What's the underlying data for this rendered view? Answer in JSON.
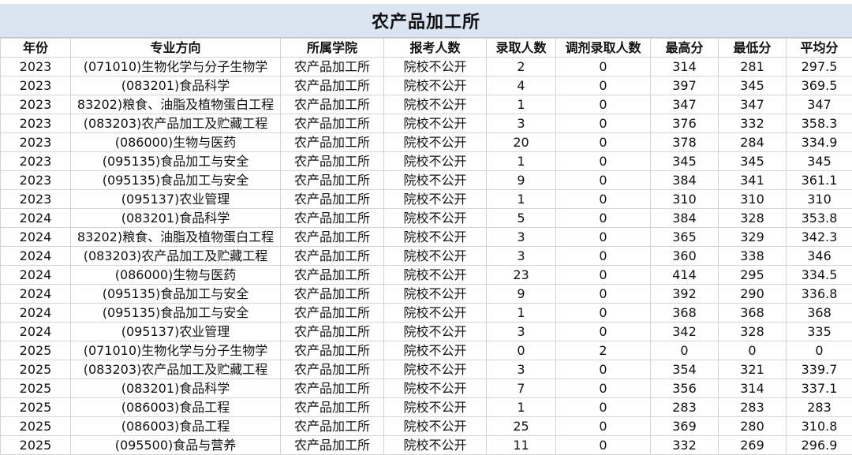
{
  "title": "农产品加工所",
  "headers": [
    "年份",
    "专业方向",
    "所属学院",
    "报考人数",
    "录取人数",
    "调剂录取人数",
    "最高分",
    "最低分",
    "平均分"
  ],
  "rows": [
    [
      "2023",
      "(071010)生物化学与分子生物学",
      "农产品加工所",
      "院校不公开",
      "2",
      "0",
      "314",
      "281",
      "297.5"
    ],
    [
      "2023",
      "(083201)食品科学",
      "农产品加工所",
      "院校不公开",
      "4",
      "0",
      "397",
      "345",
      "369.5"
    ],
    [
      "2023",
      "83202)粮食、油脂及植物蛋白工程",
      "农产品加工所",
      "院校不公开",
      "1",
      "0",
      "347",
      "347",
      "347"
    ],
    [
      "2023",
      "(083203)农产品加工及贮藏工程",
      "农产品加工所",
      "院校不公开",
      "3",
      "0",
      "376",
      "332",
      "358.3"
    ],
    [
      "2023",
      "(086000)生物与医药",
      "农产品加工所",
      "院校不公开",
      "20",
      "0",
      "378",
      "284",
      "334.9"
    ],
    [
      "2023",
      "(095135)食品加工与安全",
      "农产品加工所",
      "院校不公开",
      "1",
      "0",
      "345",
      "345",
      "345"
    ],
    [
      "2023",
      "(095135)食品加工与安全",
      "农产品加工所",
      "院校不公开",
      "9",
      "0",
      "384",
      "341",
      "361.1"
    ],
    [
      "2023",
      "(095137)农业管理",
      "农产品加工所",
      "院校不公开",
      "1",
      "0",
      "310",
      "310",
      "310"
    ],
    [
      "2024",
      "(083201)食品科学",
      "农产品加工所",
      "院校不公开",
      "5",
      "0",
      "384",
      "328",
      "353.8"
    ],
    [
      "2024",
      "83202)粮食、油脂及植物蛋白工程",
      "农产品加工所",
      "院校不公开",
      "3",
      "0",
      "365",
      "329",
      "342.3"
    ],
    [
      "2024",
      "(083203)农产品加工及贮藏工程",
      "农产品加工所",
      "院校不公开",
      "3",
      "0",
      "360",
      "338",
      "346"
    ],
    [
      "2024",
      "(086000)生物与医药",
      "农产品加工所",
      "院校不公开",
      "23",
      "0",
      "414",
      "295",
      "334.5"
    ],
    [
      "2024",
      "(095135)食品加工与安全",
      "农产品加工所",
      "院校不公开",
      "9",
      "0",
      "392",
      "290",
      "336.8"
    ],
    [
      "2024",
      "(095135)食品加工与安全",
      "农产品加工所",
      "院校不公开",
      "1",
      "0",
      "368",
      "368",
      "368"
    ],
    [
      "2024",
      "(095137)农业管理",
      "农产品加工所",
      "院校不公开",
      "3",
      "0",
      "342",
      "328",
      "335"
    ],
    [
      "2025",
      "(071010)生物化学与分子生物学",
      "农产品加工所",
      "院校不公开",
      "0",
      "2",
      "0",
      "0",
      "0"
    ],
    [
      "2025",
      "(083203)农产品加工及贮藏工程",
      "农产品加工所",
      "院校不公开",
      "3",
      "0",
      "354",
      "321",
      "339.7"
    ],
    [
      "2025",
      "(083201)食品科学",
      "农产品加工所",
      "院校不公开",
      "7",
      "0",
      "356",
      "314",
      "337.1"
    ],
    [
      "2025",
      "(086003)食品工程",
      "农产品加工所",
      "院校不公开",
      "1",
      "0",
      "283",
      "283",
      "283"
    ],
    [
      "2025",
      "(086003)食品工程",
      "农产品加工所",
      "院校不公开",
      "25",
      "0",
      "369",
      "280",
      "310.8"
    ],
    [
      "2025",
      "(095500)食品与营养",
      "农产品加工所",
      "院校不公开",
      "11",
      "0",
      "332",
      "269",
      "296.9"
    ]
  ]
}
